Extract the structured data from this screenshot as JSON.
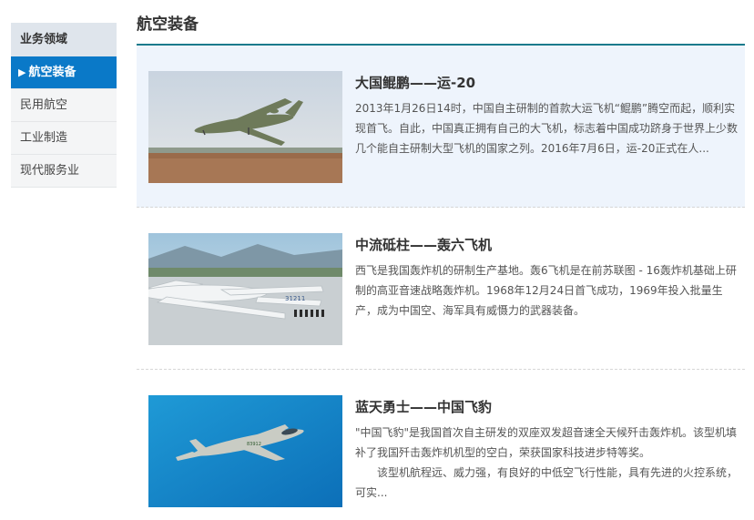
{
  "sidebar": {
    "header": "业务领域",
    "items": [
      {
        "label": "航空装备",
        "active": true
      },
      {
        "label": "民用航空",
        "active": false
      },
      {
        "label": "工业制造",
        "active": false
      },
      {
        "label": "现代服务业",
        "active": false
      }
    ]
  },
  "main": {
    "title": "航空装备",
    "articles": [
      {
        "title": "大国鲲鹏——运-20",
        "summary": "2013年1月26日14时，中国自主研制的首款大运飞机“鲲鹏”腾空而起，顺利实现首飞。自此，中国真正拥有自己的大飞机，标志着中国成功跻身于世界上少数几个能自主研制大型飞机的国家之列。2016年7月6日，运-20正式在人...",
        "image": "cargo-aircraft-takeoff-photo"
      },
      {
        "title": "中流砥柱——轰六飞机",
        "summary": "西飞是我国轰炸机的研制生产基地。轰6飞机是在前苏联图 - 16轰炸机基础上研制的高亚音速战略轰炸机。1968年12月24日首飞成功，1969年投入批量生产，成为中国空、海军具有威慑力的武器装备。",
        "image": "bomber-aircraft-parked-photo"
      },
      {
        "title": "蓝天勇士——中国飞豹",
        "summary": "\"中国飞豹\"是我国首次自主研发的双座双发超音速全天候歼击轰炸机。该型机填补了我国歼击轰炸机机型的空白，荣获国家科技进步特等奖。",
        "summary2": "该型机航程远、威力强，有良好的中低空飞行性能，具有先进的火控系统，可实...",
        "image": "fighter-bomber-flying-photo"
      }
    ]
  },
  "colors": {
    "accent": "#0a79c8",
    "title_rule": "#1a7a8c",
    "highlight_row": "#eef4fc"
  }
}
